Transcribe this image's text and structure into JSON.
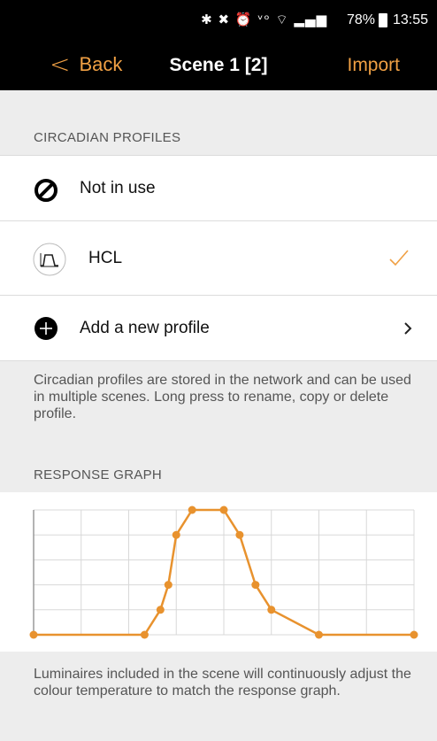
{
  "status_bar": {
    "icons": "✱ ✖ ⏰ ᵛᵒ ⌔ ▂▄▆",
    "battery": "78%",
    "time": "13:55"
  },
  "nav": {
    "back_label": "Back",
    "title": "Scene 1 [2]",
    "import_label": "Import"
  },
  "circadian": {
    "header": "CIRCADIAN PROFILES",
    "items": [
      {
        "label": "Not in use",
        "icon": "prohibited-icon"
      },
      {
        "label": "HCL",
        "icon": "curve-icon",
        "selected": true
      },
      {
        "label": "Add a new profile",
        "icon": "plus-circle-icon"
      }
    ],
    "description": "Circadian profiles are stored in the network and can be used in multiple scenes. Long press to rename, copy or delete profile."
  },
  "response": {
    "header": "RESPONSE GRAPH",
    "description": "Luminaires included in the scene will continuously adjust the colour temperature to match the response graph."
  },
  "colors": {
    "accent": "#f0a044",
    "line": "#e8922e"
  },
  "chart_data": {
    "type": "line",
    "x": [
      0,
      3.5,
      4,
      4.25,
      4.5,
      5,
      6,
      6.5,
      7,
      7.5,
      9,
      12
    ],
    "y": [
      0,
      0,
      1,
      2,
      4,
      5,
      5,
      4,
      2,
      1,
      0,
      0
    ],
    "xlim": [
      0,
      12
    ],
    "ylim": [
      0,
      5
    ],
    "grid": true
  }
}
